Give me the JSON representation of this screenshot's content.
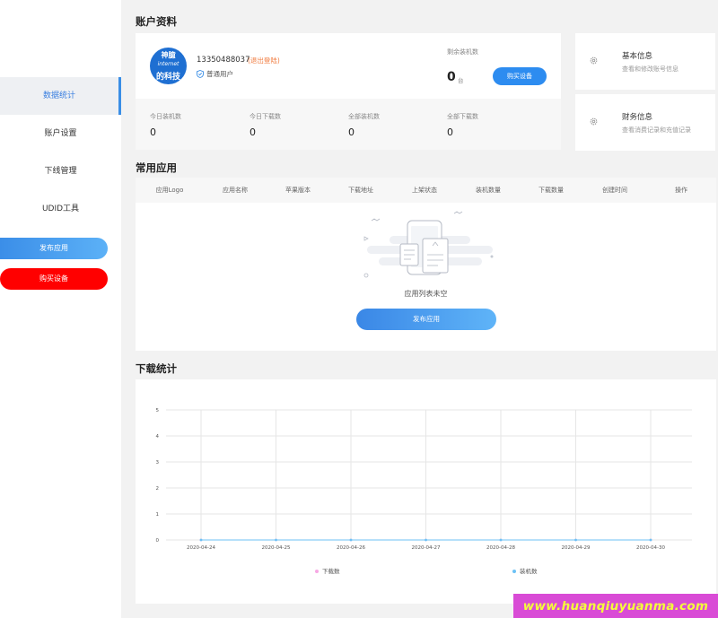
{
  "sidebar": {
    "items": [
      {
        "label": "数据统计",
        "active": true
      },
      {
        "label": "账户设置",
        "active": false
      },
      {
        "label": "下线管理",
        "active": false
      },
      {
        "label": "UDID工具",
        "active": false
      }
    ],
    "publish_label": "发布应用",
    "buy_label": "购买设备"
  },
  "account": {
    "section_title": "账户资料",
    "logo_text": [
      "神臆",
      "internet",
      "的科技"
    ],
    "phone": "13350488037",
    "logout_label": "(退出登陆)",
    "role": "普通用户",
    "remain_label": "剩余装机数",
    "remain_value": "0",
    "remain_unit": "台",
    "buy_button": "购买设备",
    "stats": [
      {
        "label": "今日装机数",
        "value": "0"
      },
      {
        "label": "今日下载数",
        "value": "0"
      },
      {
        "label": "全部装机数",
        "value": "0"
      },
      {
        "label": "全部下载数",
        "value": "0"
      }
    ]
  },
  "info_cards": [
    {
      "title": "基本信息",
      "desc": "查看和修改账号信息",
      "icon": "gear-icon"
    },
    {
      "title": "财务信息",
      "desc": "查看消费记录和充值记录",
      "icon": "gear-icon"
    }
  ],
  "apps": {
    "section_title": "常用应用",
    "columns": [
      "应用Logo",
      "应用名称",
      "苹果版本",
      "下载地址",
      "上架状态",
      "装机数量",
      "下载数量",
      "创建时间",
      "操作"
    ],
    "empty_text": "应用列表未空",
    "publish_button": "发布应用"
  },
  "downloads": {
    "section_title": "下载统计"
  },
  "chart_data": {
    "type": "line",
    "categories": [
      "2020-04-24",
      "2020-04-25",
      "2020-04-26",
      "2020-04-27",
      "2020-04-28",
      "2020-04-29",
      "2020-04-30"
    ],
    "series": [
      {
        "name": "下载数",
        "values": [
          0,
          0,
          0,
          0,
          0,
          0,
          0
        ],
        "color": "#f7a8e4"
      },
      {
        "name": "装机数",
        "values": [
          0,
          0,
          0,
          0,
          0,
          0,
          0
        ],
        "color": "#6cc2f5"
      }
    ],
    "y_ticks": [
      "0",
      "1",
      "2",
      "3",
      "4",
      "5"
    ],
    "ylim": [
      0,
      5
    ],
    "grid": true,
    "legend": "bottom"
  },
  "watermark": "www.huanqiuyuanma.com",
  "colors": {
    "accent": "#2d8cf0",
    "danger": "#ff0000",
    "orange": "#f07b3f"
  }
}
